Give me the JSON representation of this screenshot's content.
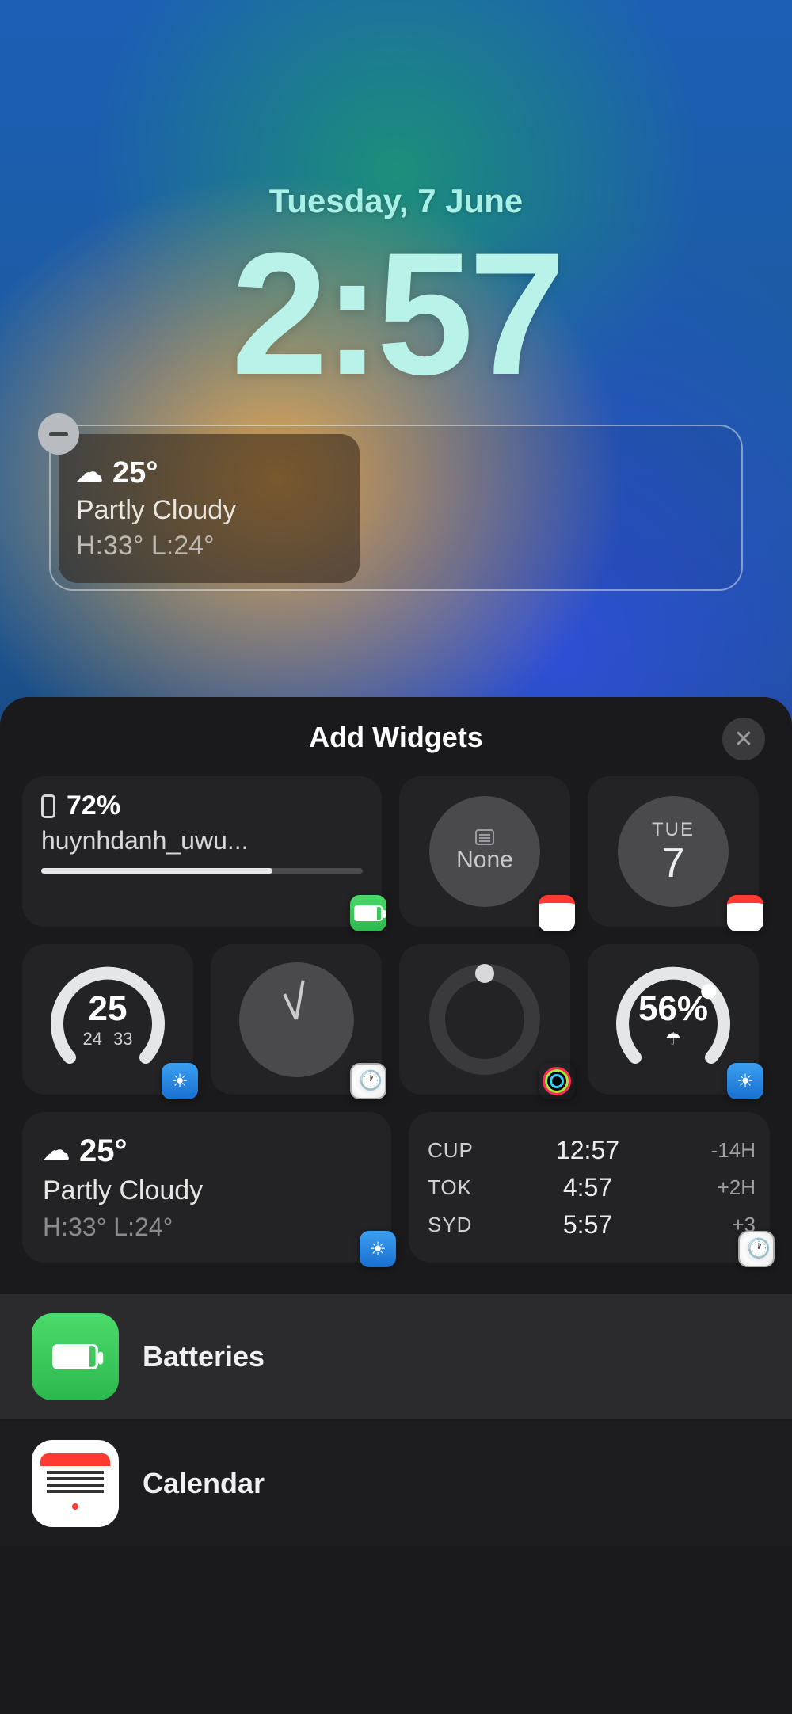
{
  "lockscreen": {
    "date": "Tuesday, 7 June",
    "time": "2:57"
  },
  "slot_widget": {
    "icon": "partly-cloudy-night",
    "temp": "25°",
    "condition": "Partly Cloudy",
    "hi_lo": "H:33° L:24°"
  },
  "sheet": {
    "title": "Add Widgets",
    "widgets": {
      "battery": {
        "pct": "72%",
        "device": "huynhdanh_uwu...",
        "fill": 72
      },
      "cal_none": {
        "label": "None"
      },
      "cal_date": {
        "dow": "TUE",
        "day": "7"
      },
      "temp_gauge": {
        "value": "25",
        "lo": "24",
        "hi": "33"
      },
      "precip_gauge": {
        "value": "56%"
      },
      "weather_summary": {
        "temp": "25°",
        "condition": "Partly Cloudy",
        "hi_lo": "H:33° L:24°"
      },
      "world_clock": [
        {
          "city": "CUP",
          "time": "12:57",
          "diff": "-14H"
        },
        {
          "city": "TOK",
          "time": "4:57",
          "diff": "+2H"
        },
        {
          "city": "SYD",
          "time": "5:57",
          "diff": "+3"
        }
      ]
    },
    "apps": {
      "batteries": "Batteries",
      "calendar": "Calendar"
    }
  }
}
